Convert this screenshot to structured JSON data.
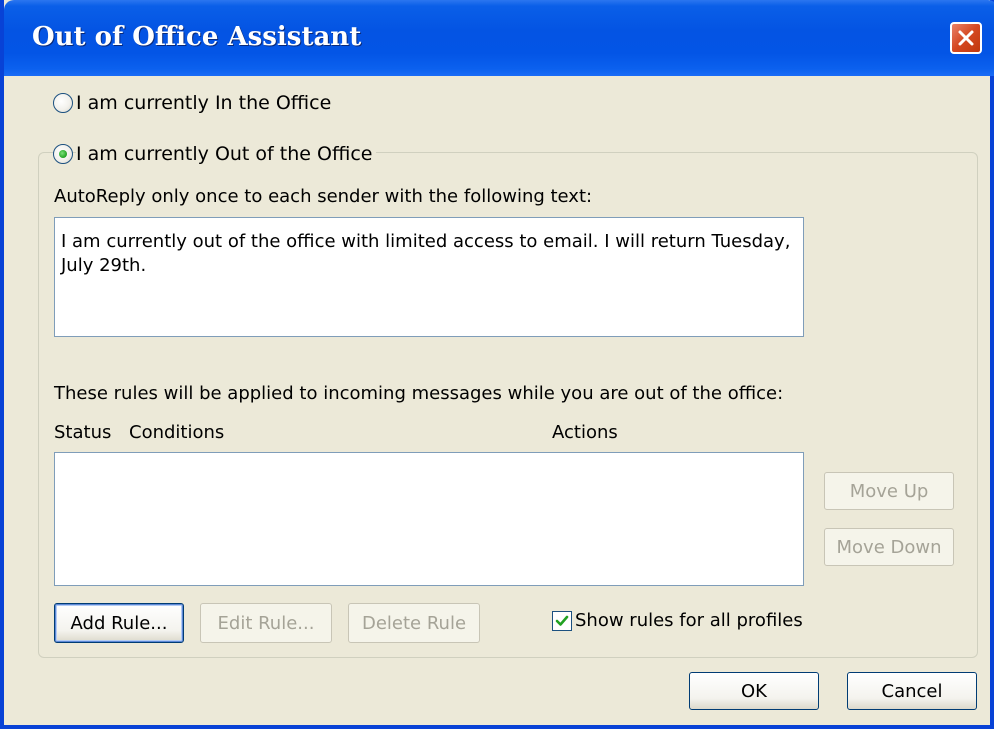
{
  "window": {
    "title": "Out of Office Assistant",
    "close_icon": "close-icon"
  },
  "status_options": {
    "in_office": {
      "label": "I am currently In the Office",
      "checked": false
    },
    "out_office": {
      "label": "I am currently Out of the Office",
      "checked": true
    }
  },
  "autoreply": {
    "label": "AutoReply only once to each sender with the following text:",
    "text": "I am currently out of the office with limited access to email. I will return Tuesday, July 29th."
  },
  "rules": {
    "label": "These rules will be applied to incoming messages while you are out of the office:",
    "columns": {
      "status": "Status",
      "conditions": "Conditions",
      "actions": "Actions"
    },
    "rows": [],
    "move_up": "Move Up",
    "move_down": "Move Down",
    "add_rule": "Add Rule...",
    "edit_rule": "Edit Rule...",
    "delete_rule": "Delete Rule",
    "show_all_profiles": {
      "label": "Show rules for all profiles",
      "checked": true
    }
  },
  "dialog_buttons": {
    "ok": "OK",
    "cancel": "Cancel"
  },
  "colors": {
    "titlebar": "#0454e3",
    "dialog_bg": "#ece9d8",
    "close_button": "#d44820"
  }
}
